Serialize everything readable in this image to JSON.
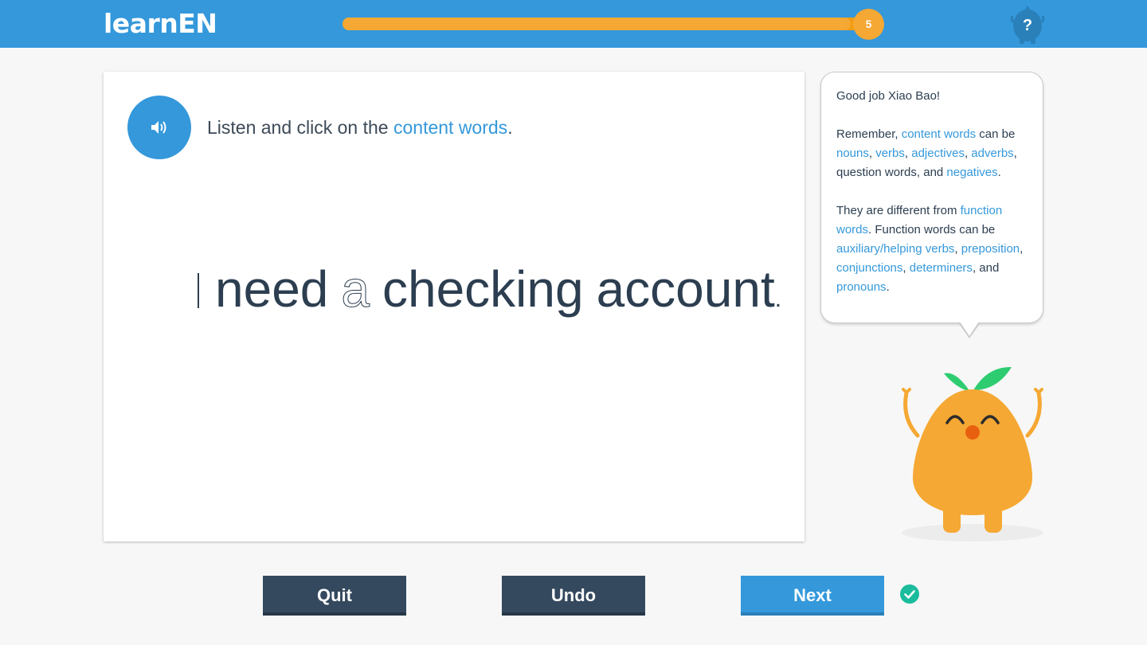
{
  "header": {
    "logo": "learnEN",
    "progress": {
      "fraction": 0.96,
      "step_label": "5"
    },
    "help_icon": "question-mascot-icon"
  },
  "exercise": {
    "audio_icon": "speaker-icon",
    "instruction": {
      "prefix": "Listen and click on the ",
      "link": "content words",
      "suffix": "."
    },
    "sentence": {
      "words": [
        {
          "text": "I",
          "kind": "function"
        },
        {
          "text": "need",
          "kind": "content"
        },
        {
          "text": "a",
          "kind": "function"
        },
        {
          "text": "checking",
          "kind": "content"
        },
        {
          "text": "account",
          "kind": "content"
        },
        {
          "text": ".",
          "kind": "punctuation"
        }
      ]
    }
  },
  "tip": {
    "greeting": "Good job Xiao Bao!",
    "p2": {
      "t1": "Remember, ",
      "l1": "content words",
      "t2": " can be ",
      "l2": "nouns",
      "t3": ", ",
      "l3": "verbs",
      "t4": ", ",
      "l4": "adjectives",
      "t5": ", ",
      "l5": "adverbs",
      "t6": ", question words, and ",
      "l6": "negatives",
      "t7": "."
    },
    "p3": {
      "t1": "They are different from ",
      "l1": "function words",
      "t2": ". Function words can be ",
      "l2": "auxiliary/helping verbs",
      "t3": ", ",
      "l3": "preposition",
      "t4": ", ",
      "l4": "conjunctions",
      "t5": ", ",
      "l5": "determiners",
      "t6": ", and ",
      "l6": "pronouns",
      "t7": "."
    }
  },
  "actions": {
    "quit_label": "Quit",
    "undo_label": "Undo",
    "next_label": "Next",
    "status_icon": "check-circle-icon"
  },
  "colors": {
    "brand_blue": "#3498db",
    "progress_orange": "#f5a833",
    "dark_button": "#34495e",
    "success_green": "#1abc9c"
  }
}
